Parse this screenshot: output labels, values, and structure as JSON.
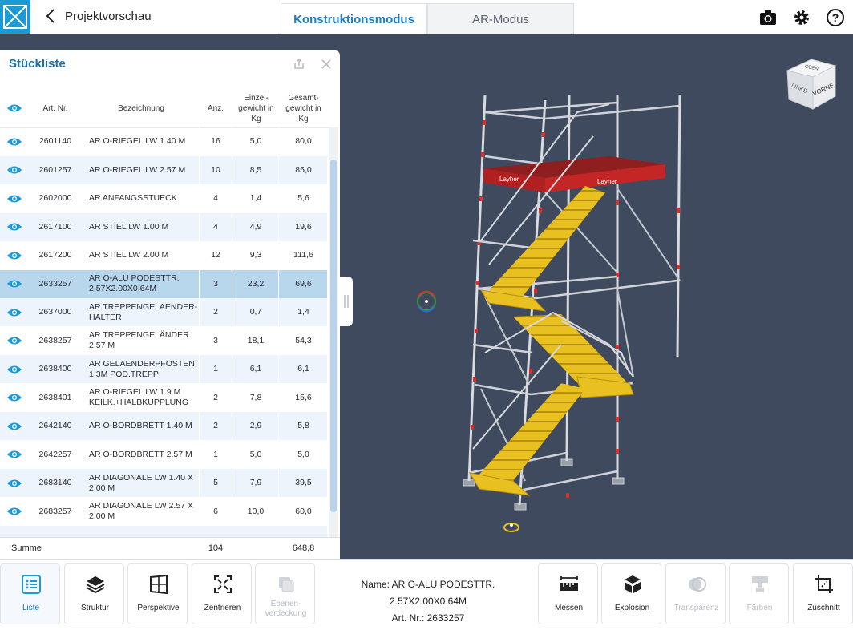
{
  "header": {
    "back_label": "Projektvorschau",
    "tabs": [
      {
        "label": "Konstruktionsmodus",
        "active": true
      },
      {
        "label": "AR-Modus",
        "active": false
      }
    ],
    "icons": [
      "camera-icon",
      "gear-icon",
      "help-icon"
    ]
  },
  "parts_list": {
    "title": "Stückliste",
    "columns": [
      "Art. Nr.",
      "Bezeichnung",
      "Anz.",
      "Einzel-gewicht in Kg",
      "Gesamt-gewicht in Kg"
    ],
    "rows": [
      {
        "art": "2601140",
        "name": "AR O-RIEGEL LW 1.40 M",
        "qty": "16",
        "ew": "5,0",
        "gw": "80,0"
      },
      {
        "art": "2601257",
        "name": "AR O-RIEGEL LW 2.57 M",
        "qty": "10",
        "ew": "8,5",
        "gw": "85,0"
      },
      {
        "art": "2602000",
        "name": "AR ANFANGSSTUECK",
        "qty": "4",
        "ew": "1,4",
        "gw": "5,6"
      },
      {
        "art": "2617100",
        "name": "AR STIEL LW 1.00 M",
        "qty": "4",
        "ew": "4,9",
        "gw": "19,6"
      },
      {
        "art": "2617200",
        "name": "AR STIEL LW 2.00 M",
        "qty": "12",
        "ew": "9,3",
        "gw": "111,6"
      },
      {
        "art": "2633257",
        "name": "AR O-ALU PODESTTR. 2.57X2.00X0.64M",
        "qty": "3",
        "ew": "23,2",
        "gw": "69,6",
        "selected": true
      },
      {
        "art": "2637000",
        "name": "AR TREPPENGELAENDER-HALTER",
        "qty": "2",
        "ew": "0,7",
        "gw": "1,4"
      },
      {
        "art": "2638257",
        "name": "AR TREPPENGELÄNDER 2.57 M",
        "qty": "3",
        "ew": "18,1",
        "gw": "54,3"
      },
      {
        "art": "2638400",
        "name": "AR GELAENDERPFOSTEN 1.3M POD.TREPP",
        "qty": "1",
        "ew": "6,1",
        "gw": "6,1"
      },
      {
        "art": "2638401",
        "name": "AR O-RIEGEL LW 1.9 M KEILK.+HALBKUPPLUNG",
        "qty": "2",
        "ew": "7,8",
        "gw": "15,6"
      },
      {
        "art": "2642140",
        "name": "AR O-BORDBRETT 1.40 M",
        "qty": "2",
        "ew": "2,9",
        "gw": "5,8"
      },
      {
        "art": "2642257",
        "name": "AR O-BORDBRETT 2.57 M",
        "qty": "1",
        "ew": "5,0",
        "gw": "5,0"
      },
      {
        "art": "2683140",
        "name": "AR DIAGONALE LW 1.40 X 2.00 M",
        "qty": "5",
        "ew": "7,9",
        "gw": "39,5"
      },
      {
        "art": "2683257",
        "name": "AR DIAGONALE LW 2.57 X 2.00 M",
        "qty": "6",
        "ew": "10,0",
        "gw": "60,0"
      }
    ],
    "sum": {
      "label": "Summe",
      "qty": "104",
      "total": "648,8"
    }
  },
  "viewcube": {
    "top": "OBEN",
    "left": "LINKS",
    "front": "VORNE"
  },
  "model_label": "Layher",
  "toolbar": {
    "left": [
      {
        "label": "Liste",
        "icon": "list-icon",
        "active": true
      },
      {
        "label": "Struktur",
        "icon": "layers-icon"
      },
      {
        "label": "Perspektive",
        "icon": "perspective-icon"
      },
      {
        "label": "Zentrieren",
        "icon": "center-icon"
      },
      {
        "label": "Ebenen-verdeckung",
        "icon": "layer-hide-icon",
        "disabled": true
      }
    ],
    "right": [
      {
        "label": "Messen",
        "icon": "ruler-icon"
      },
      {
        "label": "Explosion",
        "icon": "explosion-icon"
      },
      {
        "label": "Transparenz",
        "icon": "transparency-icon",
        "disabled": true
      },
      {
        "label": "Färben",
        "icon": "paint-icon",
        "disabled": true
      },
      {
        "label": "Zuschnitt",
        "icon": "cut-icon"
      }
    ]
  },
  "selection": {
    "name": "Name: AR O-ALU PODESTTR. 2.57X2.00X0.64M",
    "art": "Art. Nr.: 2633257"
  },
  "colors": {
    "accent": "#1b9ad6",
    "viewport": "#404a5e",
    "selection": "#b8d6ec",
    "scaffold_yellow": "#e8c020",
    "deck_red": "#b02020"
  }
}
